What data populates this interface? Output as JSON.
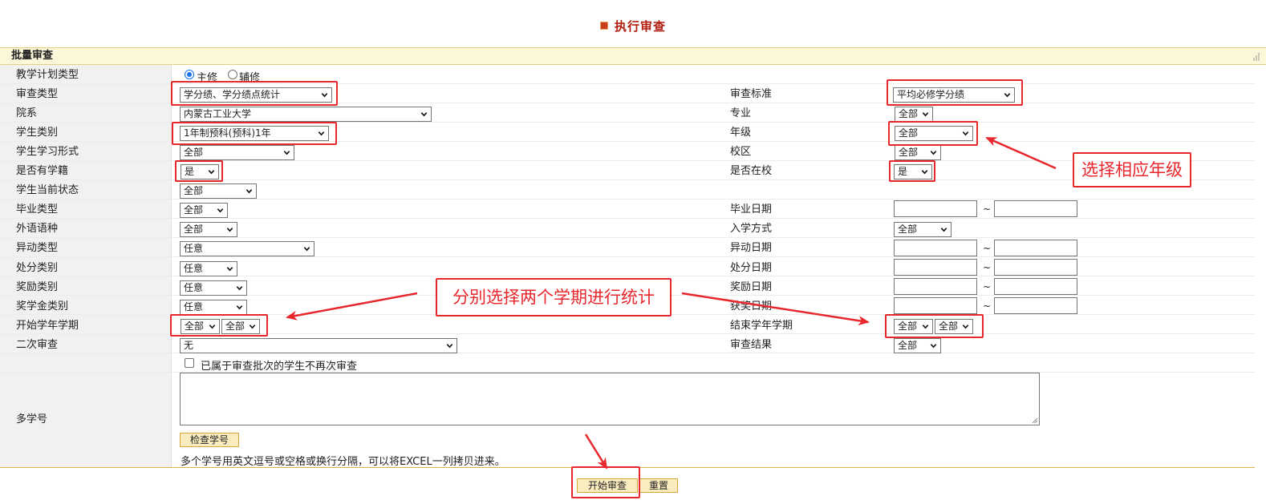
{
  "page": {
    "title": "执行审查"
  },
  "section": {
    "title": "批量审查"
  },
  "fields": {
    "plan_type": {
      "label": "教学计划类型",
      "options": [
        "主修",
        "辅修"
      ],
      "selected": "主修"
    },
    "review_type": {
      "label": "审查类型",
      "value": "学分绩、学分绩点统计"
    },
    "review_standard": {
      "label": "审查标准",
      "value": "平均必修学分绩"
    },
    "department": {
      "label": "院系",
      "value": "内蒙古工业大学"
    },
    "major": {
      "label": "专业",
      "value": "全部"
    },
    "student_category": {
      "label": "学生类别",
      "value": "1年制预科(预科)1年"
    },
    "grade": {
      "label": "年级",
      "value": "全部"
    },
    "study_form": {
      "label": "学生学习形式",
      "value": "全部"
    },
    "campus": {
      "label": "校区",
      "value": "全部"
    },
    "has_enrollment": {
      "label": "是否有学籍",
      "value": "是"
    },
    "at_school": {
      "label": "是否在校",
      "value": "是"
    },
    "current_status": {
      "label": "学生当前状态",
      "value": "全部"
    },
    "graduation_type": {
      "label": "毕业类型",
      "value": "全部"
    },
    "graduation_date": {
      "label": "毕业日期",
      "from": "",
      "to": ""
    },
    "foreign_language": {
      "label": "外语语种",
      "value": "全部"
    },
    "admission_method": {
      "label": "入学方式",
      "value": "全部"
    },
    "change_type": {
      "label": "异动类型",
      "value": "任意"
    },
    "change_date": {
      "label": "异动日期",
      "from": "",
      "to": ""
    },
    "punishment_type": {
      "label": "处分类别",
      "value": "任意"
    },
    "punishment_date": {
      "label": "处分日期",
      "from": "",
      "to": ""
    },
    "award_type": {
      "label": "奖励类别",
      "value": "任意"
    },
    "award_date": {
      "label": "奖励日期",
      "from": "",
      "to": ""
    },
    "scholarship_type": {
      "label": "奖学金类别",
      "value": "任意"
    },
    "prize_date": {
      "label": "获奖日期",
      "from": "",
      "to": ""
    },
    "start_term": {
      "label": "开始学年学期",
      "year": "全部",
      "term": "全部"
    },
    "end_term": {
      "label": "结束学年学期",
      "year": "全部",
      "term": "全部"
    },
    "second_review": {
      "label": "二次审查",
      "value": "无"
    },
    "review_result": {
      "label": "审查结果",
      "value": "全部"
    },
    "skip_reviewed": {
      "label": "已属于审查批次的学生不再次审查",
      "checked": false
    },
    "multi_id": {
      "label": "多学号",
      "value": "",
      "check_button": "检查学号",
      "hint": "多个学号用英文逗号或空格或换行分隔，可以将EXCEL一列拷贝进来。"
    }
  },
  "tilde": "~",
  "buttons": {
    "start": "开始审查",
    "reset": "重置"
  },
  "annotations": {
    "grade_callout": "选择相应年级",
    "term_callout": "分别选择两个学期进行统计",
    "color": "#e8272d"
  }
}
